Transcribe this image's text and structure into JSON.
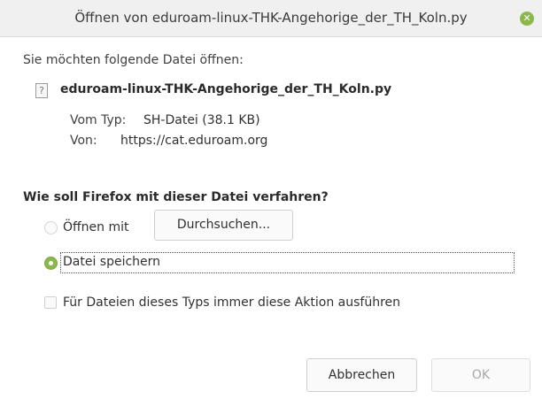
{
  "window": {
    "title": "Öffnen von eduroam-linux-THK-Angehorige_der_TH_Koln.py",
    "close_icon": "close-icon",
    "close_glyph": "✕",
    "accent": "#8ab84a"
  },
  "dialog": {
    "prompt": "Sie möchten folgende Datei öffnen:",
    "file_icon": "unknown-file-icon",
    "file_icon_glyph": "?",
    "filename": "eduroam-linux-THK-Angehorige_der_TH_Koln.py",
    "type_label": "Vom Typ:",
    "type_value": "SH-Datei (38.1 KB)",
    "from_label": "Von:",
    "from_value": "https://cat.eduroam.org",
    "question": "Wie soll Firefox mit dieser Datei verfahren?",
    "open_with_label": "Öffnen mit",
    "open_with_selected": false,
    "browse_button": "Durchsuchen...",
    "save_label": "Datei speichern",
    "save_selected": true,
    "always_label": "Für Dateien dieses Typs immer diese Aktion ausführen",
    "always_checked": false
  },
  "buttons": {
    "cancel": "Abbrechen",
    "ok": "OK",
    "ok_enabled": false
  }
}
